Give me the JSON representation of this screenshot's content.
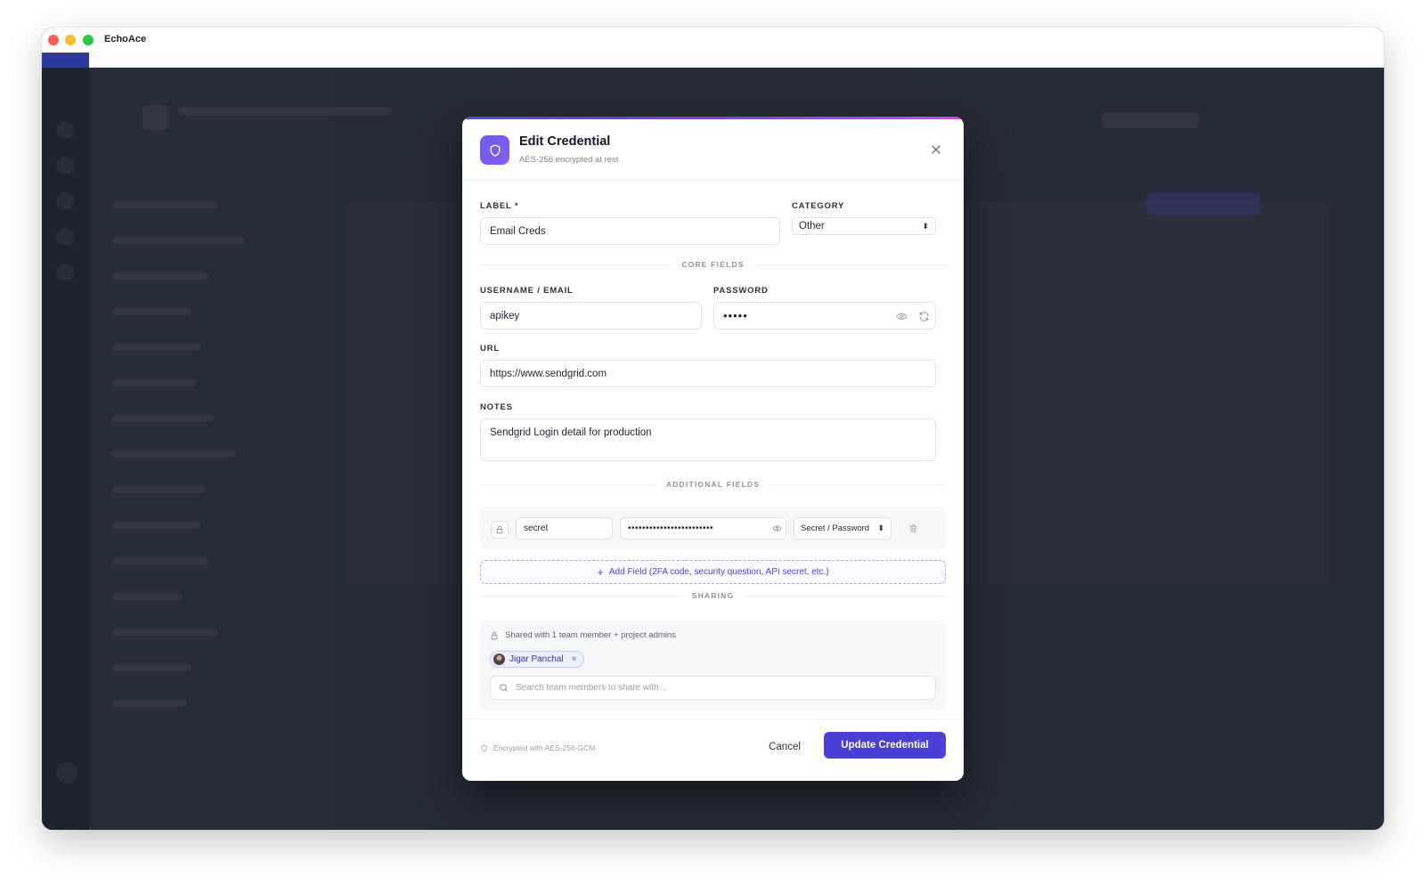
{
  "app": {
    "title": "EchoAce"
  },
  "modal": {
    "title": "Edit Credential",
    "subtitle": "AES-256 encrypted at rest",
    "label": {
      "label": "LABEL *",
      "value": "Email Creds"
    },
    "category": {
      "label": "CATEGORY",
      "value": "Other"
    },
    "sections": {
      "core": "CORE FIELDS",
      "additional": "ADDITIONAL FIELDS",
      "sharing": "SHARING"
    },
    "username": {
      "label": "USERNAME / EMAIL",
      "value": "apikey"
    },
    "password": {
      "label": "PASSWORD",
      "value": "•••••"
    },
    "url": {
      "label": "URL",
      "value": "https://www.sendgrid.com"
    },
    "notes": {
      "label": "NOTES",
      "value": "Sendgrid Login detail for production"
    },
    "additional_field": {
      "name": "secret",
      "value": "••••••••••••••••••••••••",
      "type": "Secret / Password"
    },
    "add_field_label": "Add Field (2FA code, security question, API secret, etc.)",
    "sharing": {
      "note": "Shared with 1 team member + project admins",
      "members": [
        "Jigar Panchal"
      ],
      "search_placeholder": "Search team members to share with..."
    },
    "footer": {
      "note": "Encrypted with AES-256-GCM",
      "cancel_label": "Cancel",
      "submit_label": "Update Credential"
    }
  },
  "colors": {
    "accent": "#4a3fd6",
    "overlay": "#262b38"
  }
}
